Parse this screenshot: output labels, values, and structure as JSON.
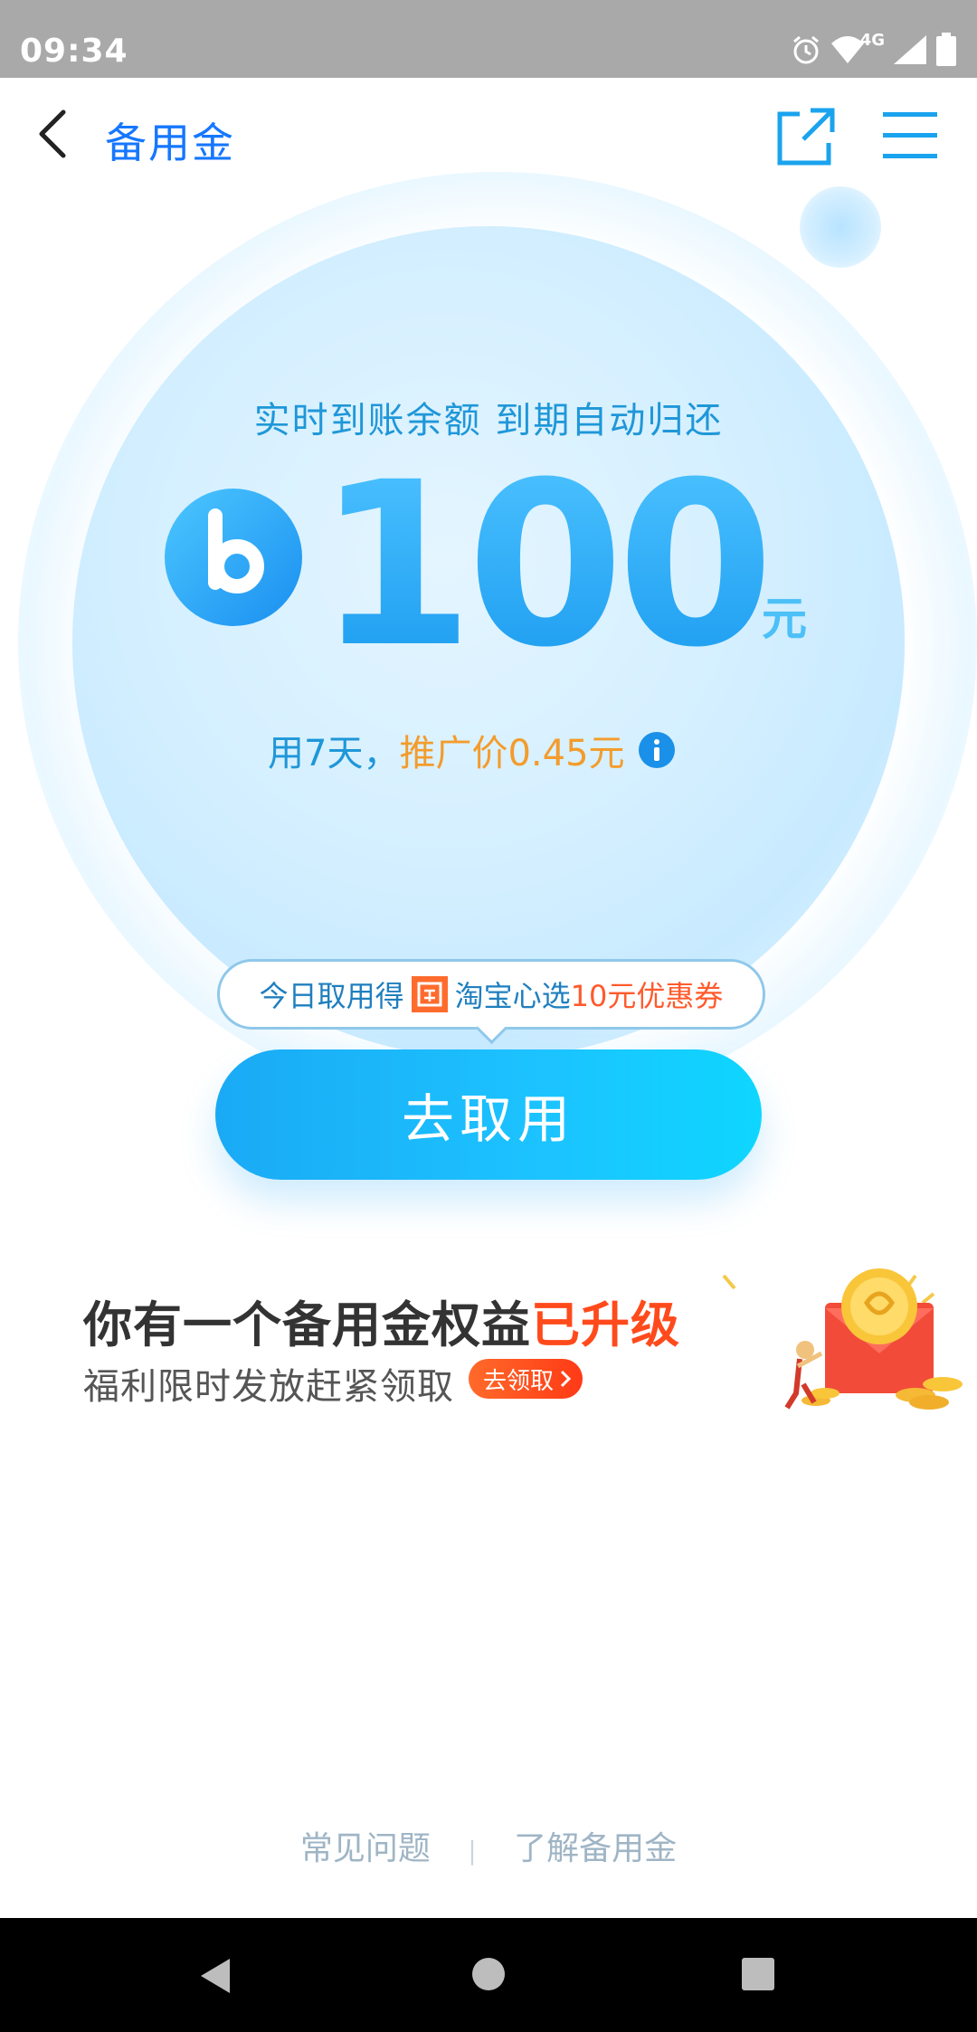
{
  "status": {
    "time": "09:34",
    "network": "4G"
  },
  "header": {
    "title": "备用金"
  },
  "hero": {
    "tagline": "实时到账余额 到期自动归还",
    "amount": "100",
    "unit": "元",
    "price_prefix": "用7天，",
    "price_promo": "推广价0.45元"
  },
  "coupon_tip": {
    "text_prefix": "今日取用得",
    "text_store": "淘宝心选",
    "text_highlight": "10元优惠券"
  },
  "cta": {
    "label": "去取用"
  },
  "promo": {
    "title": "你有一个备用金权益",
    "title_highlight": "已升级",
    "subtitle": "福利限时发放赶紧领取",
    "badge": "去领取"
  },
  "footer": {
    "faq": "常见问题",
    "about": "了解备用金"
  },
  "colors": {
    "accent": "#1677ff",
    "cta": "#1cc3ff",
    "orange": "#f39c2d",
    "red": "#ff4a1c"
  }
}
